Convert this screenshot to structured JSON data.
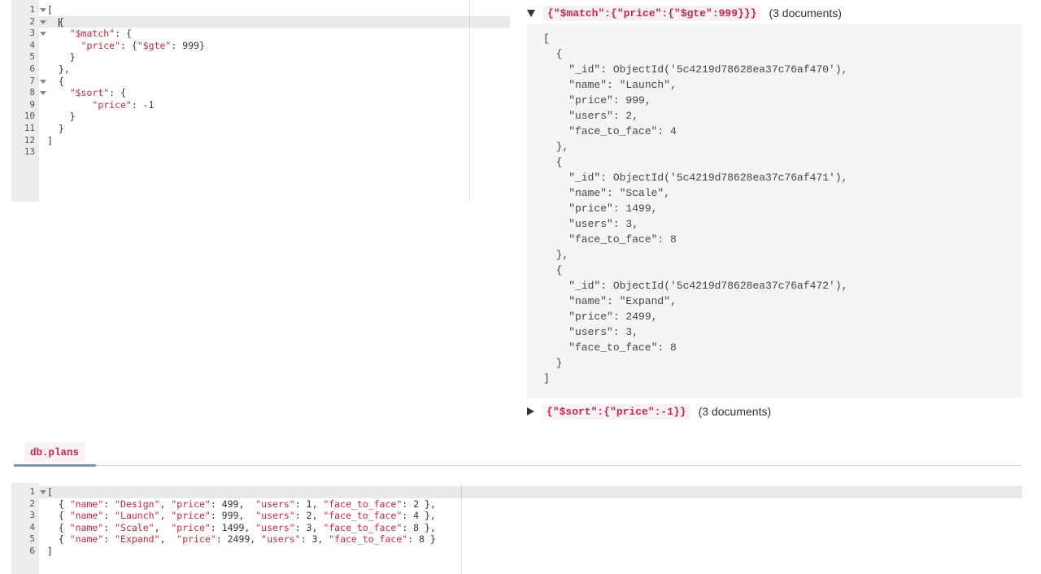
{
  "colors": {
    "chip_text": "#c7254e",
    "chip_bg": "#f9f2f4",
    "editor_string": "#c2283f",
    "editor_plain": "#333333",
    "gutter_bg": "#ededed",
    "active_line_bg": "#e9e9e9",
    "result_box_bg": "#f5f5f5",
    "tab_underline": "#7e99a9"
  },
  "icons": {
    "stage1_toggle": "triangle-down-icon",
    "stage2_toggle": "triangle-right-icon",
    "editor_fold": "fold-arrow-icon"
  },
  "query_editor": {
    "lines": [
      {
        "n": "1",
        "fold": true,
        "tokens": [
          [
            "p",
            "["
          ]
        ]
      },
      {
        "n": "2",
        "fold": true,
        "active": true,
        "tokens": [
          [
            "p",
            "  "
          ],
          [
            "c",
            ""
          ],
          [
            "p",
            "{"
          ]
        ]
      },
      {
        "n": "3",
        "fold": true,
        "tokens": [
          [
            "p",
            "    "
          ],
          [
            "k",
            "\"$match\""
          ],
          [
            "p",
            ": {"
          ]
        ]
      },
      {
        "n": "4",
        "tokens": [
          [
            "p",
            "      "
          ],
          [
            "k",
            "\"price\""
          ],
          [
            "p",
            ": {"
          ],
          [
            "k",
            "\"$gte\""
          ],
          [
            "p",
            ": 999}"
          ]
        ]
      },
      {
        "n": "5",
        "tokens": [
          [
            "p",
            "    }"
          ]
        ]
      },
      {
        "n": "6",
        "tokens": [
          [
            "p",
            "  },"
          ]
        ]
      },
      {
        "n": "7",
        "fold": true,
        "tokens": [
          [
            "p",
            "  {"
          ]
        ]
      },
      {
        "n": "8",
        "fold": true,
        "tokens": [
          [
            "p",
            "    "
          ],
          [
            "k",
            "\"$sort\""
          ],
          [
            "p",
            ": {"
          ]
        ]
      },
      {
        "n": "9",
        "tokens": [
          [
            "p",
            "        "
          ],
          [
            "k",
            "\"price\""
          ],
          [
            "p",
            ": -1"
          ]
        ]
      },
      {
        "n": "10",
        "tokens": [
          [
            "p",
            "    }"
          ]
        ]
      },
      {
        "n": "11",
        "tokens": [
          [
            "p",
            "  }"
          ]
        ]
      },
      {
        "n": "12",
        "tokens": [
          [
            "p",
            "]"
          ]
        ]
      },
      {
        "n": "13",
        "tokens": []
      }
    ]
  },
  "stages": [
    {
      "query": "{\"$match\":{\"price\":{\"$gte\":999}}}",
      "count_label": "(3 documents)",
      "result_text": "[\n  {\n    \"_id\": ObjectId('5c4219d78628ea37c76af470'),\n    \"name\": \"Launch\",\n    \"price\": 999,\n    \"users\": 2,\n    \"face_to_face\": 4\n  },\n  {\n    \"_id\": ObjectId('5c4219d78628ea37c76af471'),\n    \"name\": \"Scale\",\n    \"price\": 1499,\n    \"users\": 3,\n    \"face_to_face\": 8\n  },\n  {\n    \"_id\": ObjectId('5c4219d78628ea37c76af472'),\n    \"name\": \"Expand\",\n    \"price\": 2499,\n    \"users\": 3,\n    \"face_to_face\": 8\n  }\n]"
    },
    {
      "query": "{\"$sort\":{\"price\":-1}}",
      "count_label": "(3 documents)"
    }
  ],
  "collection_tab": {
    "label": "db.plans"
  },
  "config_editor": {
    "lines": [
      {
        "n": "1",
        "fold": true,
        "active": true,
        "tokens": [
          [
            "p",
            "["
          ]
        ]
      },
      {
        "n": "2",
        "tokens": [
          [
            "p",
            "  { "
          ],
          [
            "k",
            "\"name\""
          ],
          [
            "p",
            ": "
          ],
          [
            "k",
            "\"Design\""
          ],
          [
            "p",
            ", "
          ],
          [
            "k",
            "\"price\""
          ],
          [
            "p",
            ": 499,  "
          ],
          [
            "k",
            "\"users\""
          ],
          [
            "p",
            ": 1, "
          ],
          [
            "k",
            "\"face_to_face\""
          ],
          [
            "p",
            ": 2 },"
          ]
        ]
      },
      {
        "n": "3",
        "tokens": [
          [
            "p",
            "  { "
          ],
          [
            "k",
            "\"name\""
          ],
          [
            "p",
            ": "
          ],
          [
            "k",
            "\"Launch\""
          ],
          [
            "p",
            ", "
          ],
          [
            "k",
            "\"price\""
          ],
          [
            "p",
            ": 999,  "
          ],
          [
            "k",
            "\"users\""
          ],
          [
            "p",
            ": 2, "
          ],
          [
            "k",
            "\"face_to_face\""
          ],
          [
            "p",
            ": 4 },"
          ]
        ]
      },
      {
        "n": "4",
        "tokens": [
          [
            "p",
            "  { "
          ],
          [
            "k",
            "\"name\""
          ],
          [
            "p",
            ": "
          ],
          [
            "k",
            "\"Scale\""
          ],
          [
            "p",
            ",  "
          ],
          [
            "k",
            "\"price\""
          ],
          [
            "p",
            ": 1499, "
          ],
          [
            "k",
            "\"users\""
          ],
          [
            "p",
            ": 3, "
          ],
          [
            "k",
            "\"face_to_face\""
          ],
          [
            "p",
            ": 8 },"
          ]
        ]
      },
      {
        "n": "5",
        "tokens": [
          [
            "p",
            "  { "
          ],
          [
            "k",
            "\"name\""
          ],
          [
            "p",
            ": "
          ],
          [
            "k",
            "\"Expand\""
          ],
          [
            "p",
            ",  "
          ],
          [
            "k",
            "\"price\""
          ],
          [
            "p",
            ": 2499, "
          ],
          [
            "k",
            "\"users\""
          ],
          [
            "p",
            ": 3, "
          ],
          [
            "k",
            "\"face_to_face\""
          ],
          [
            "p",
            ": 8 }"
          ]
        ]
      },
      {
        "n": "6",
        "tokens": [
          [
            "p",
            "]"
          ]
        ]
      }
    ]
  }
}
